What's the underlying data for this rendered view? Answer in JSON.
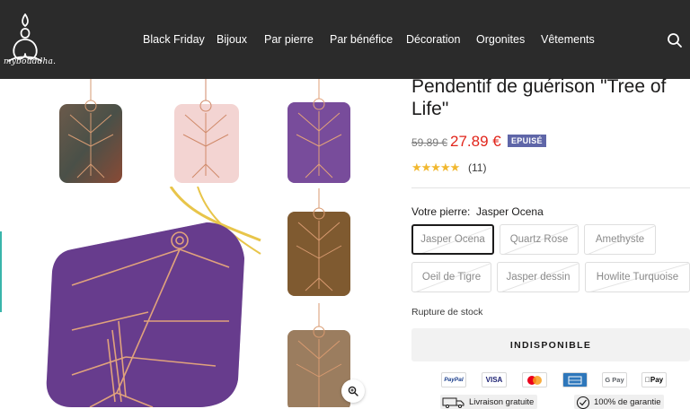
{
  "header": {
    "logo_text": "mybouddha.",
    "nav": [
      "Black Friday",
      "Bijoux",
      "Par pierre",
      "Par bénéfice",
      "Décoration",
      "Orgonites",
      "Vêtements"
    ]
  },
  "product": {
    "title_line1": "Pendentif de guérison \"Tree of",
    "title_line2": "Life\"",
    "old_price": "59.89 €",
    "new_price": "27.89 €",
    "badge": "EPUISÉ",
    "stars": "★★★★★",
    "rating_count": "(11)",
    "rating_value": 4.5,
    "stone_label": "Votre pierre:",
    "stone_selected": "Jasper Ocena",
    "stones": [
      "Jasper Ocena",
      "Quartz Rose",
      "Amethyste",
      "Oeil de Tigre",
      "Jasper dessin",
      "Howlite Turquoise"
    ],
    "stock_text": "Rupture de stock",
    "button_label": "INDISPONIBLE"
  },
  "payments": [
    "PayPal",
    "VISA",
    "Mastercard",
    "American Express",
    "G Pay",
    "Apple Pay"
  ],
  "payment_labels": {
    "paypal": "PayPal",
    "visa": "VISA",
    "gpay": "G Pay",
    "applepay": "Pay"
  },
  "features": {
    "delivery": "Livraison gratuite",
    "guarantee": "100% de garantie"
  },
  "colors": {
    "header_bg": "#2b2b2b",
    "sale_red": "#e1251b",
    "badge": "#5f66a8",
    "star": "#f1b830",
    "accent": "#39b5ab"
  }
}
